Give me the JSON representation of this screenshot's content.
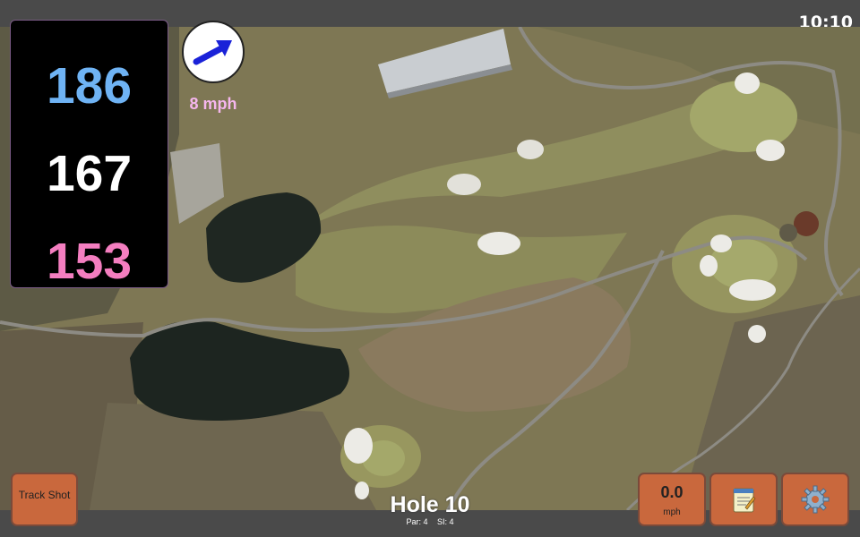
{
  "status": {
    "time": "10:10"
  },
  "distances": {
    "back": "186",
    "middle": "167",
    "front": "153"
  },
  "wind": {
    "speed_label": "8 mph",
    "direction_icon": "wind-arrow-icon"
  },
  "buttons": {
    "track_shot": "Track Shot",
    "wind_value": "0.0",
    "wind_unit": "mph",
    "notes_icon": "notepad-icon",
    "settings_icon": "gear-icon"
  },
  "hole": {
    "title": "Hole 10",
    "par": "Par: 4",
    "si": "SI: 4"
  },
  "colors": {
    "back_distance": "#6fb3f4",
    "middle_distance": "#ffffff",
    "front_distance": "#f47ec0",
    "wind_text": "#f5b6ee",
    "button": "#c9683d",
    "arrow": "#1a22d8"
  }
}
